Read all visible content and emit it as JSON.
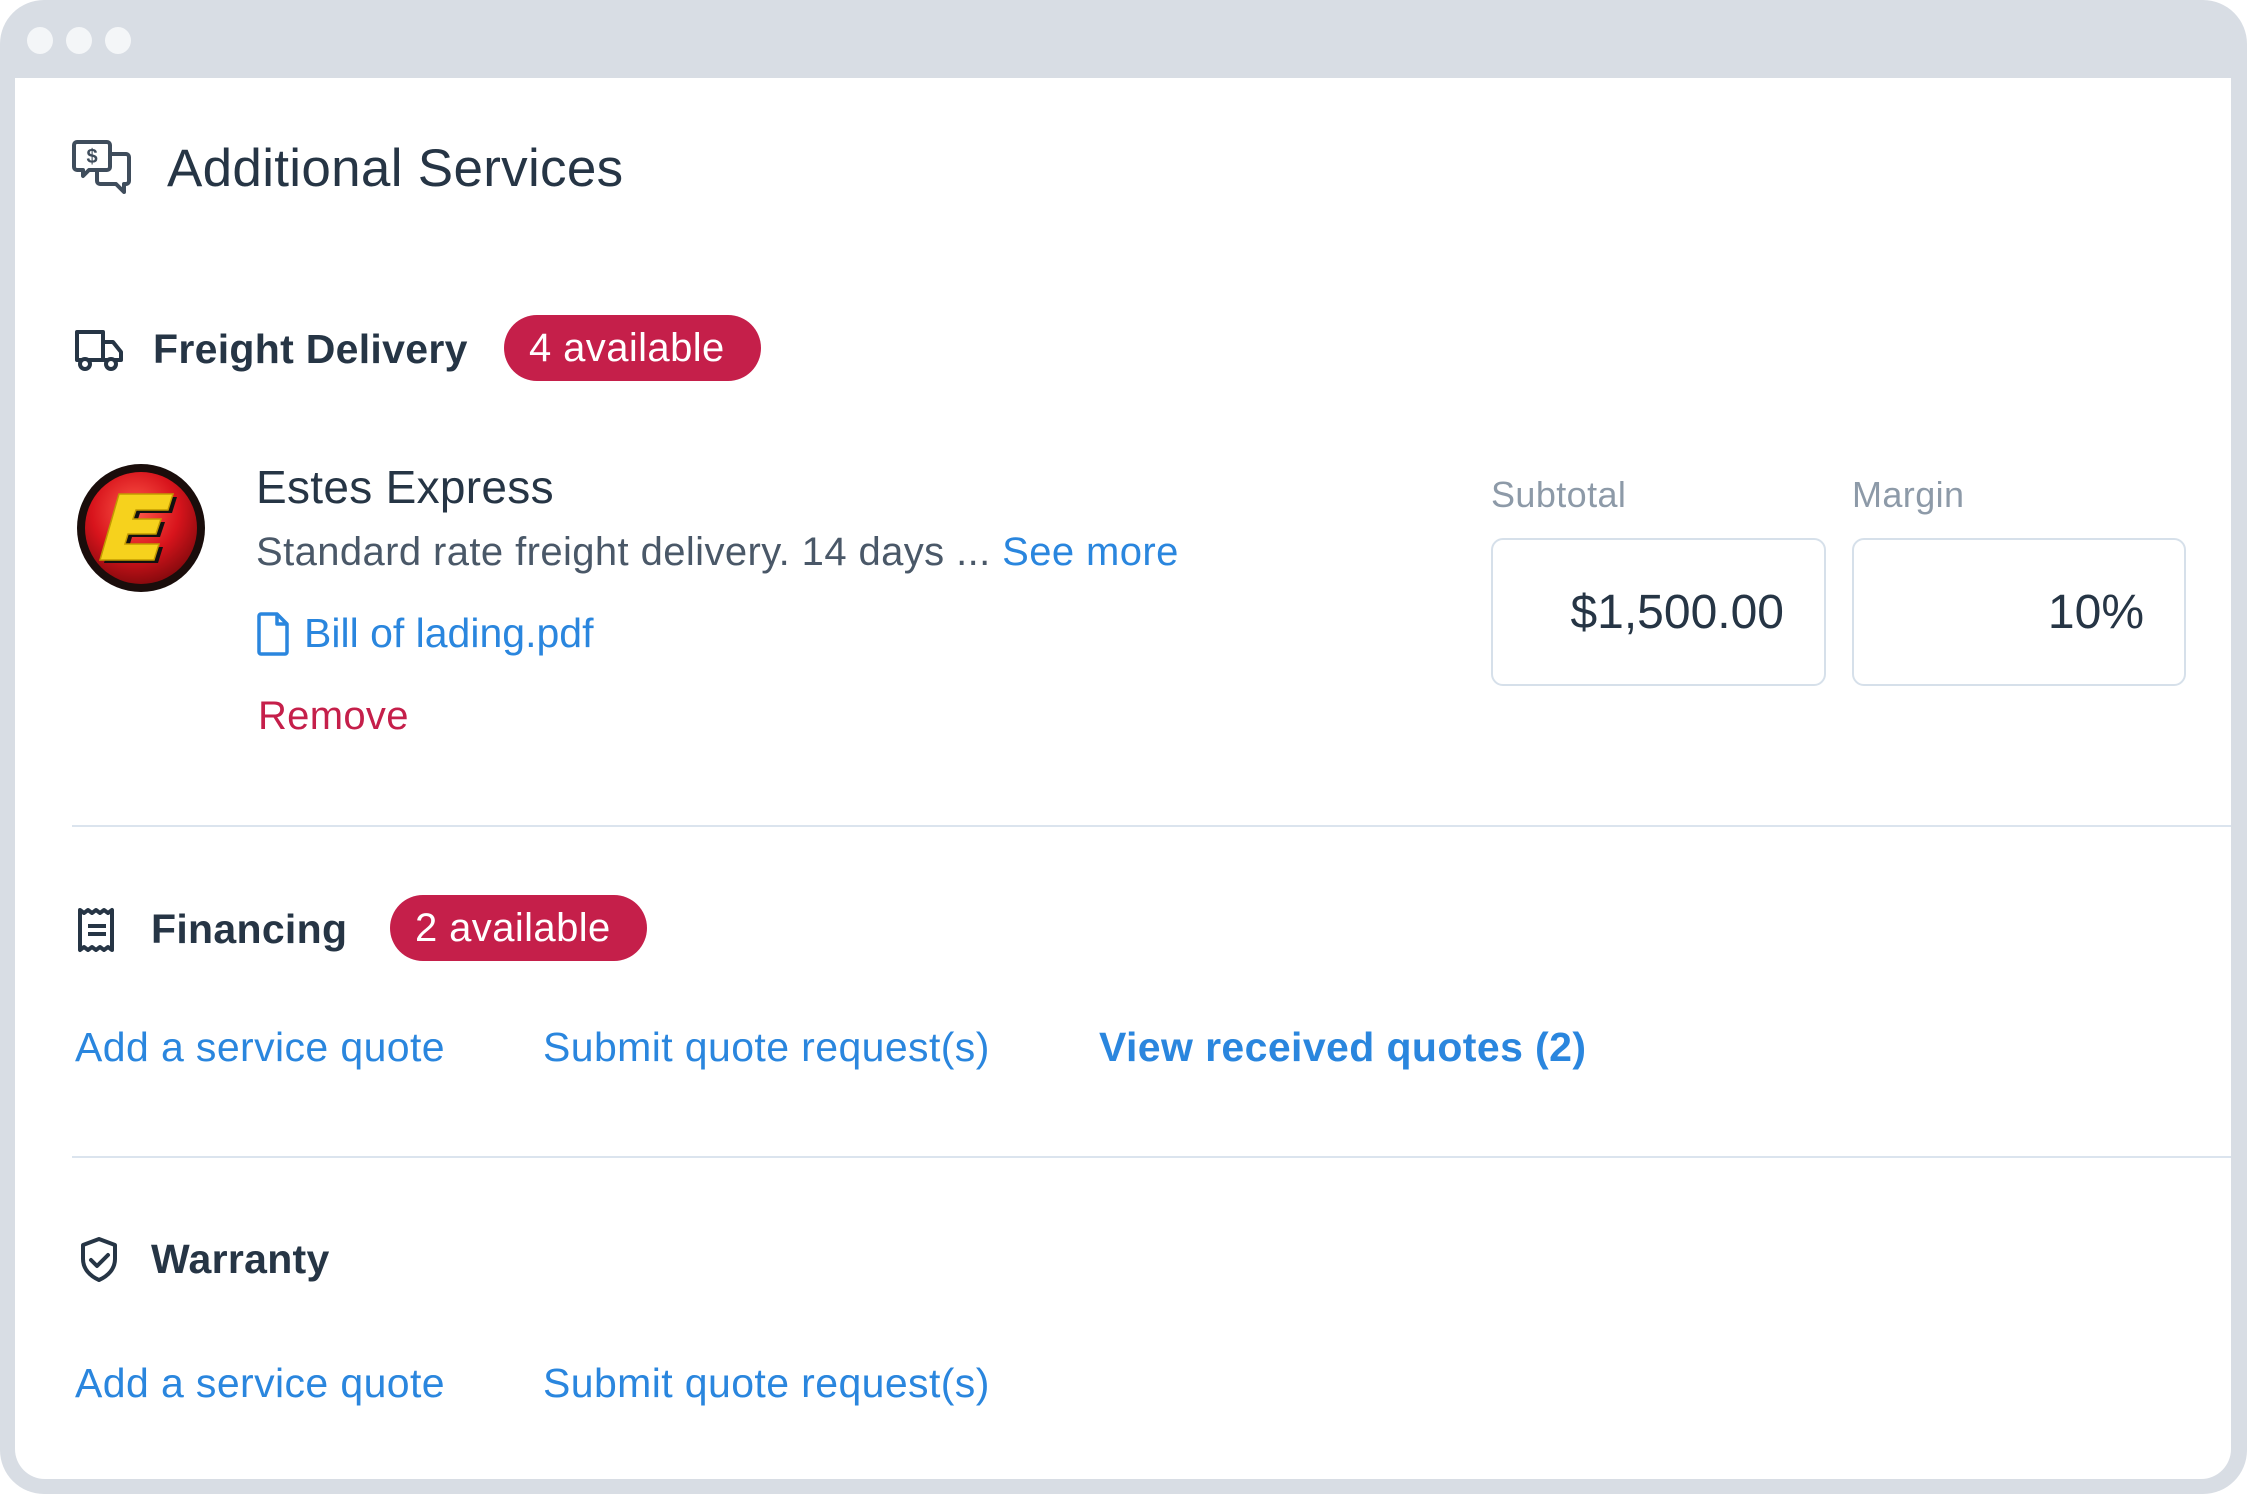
{
  "window": {
    "title": "Additional Services"
  },
  "header": {
    "icon": "chat-dollar-icon",
    "title": "Additional Services"
  },
  "sections": {
    "freight": {
      "icon": "truck-icon",
      "label": "Freight Delivery",
      "badge": "4 available",
      "vendor": {
        "logo": "estes-express-logo",
        "name": "Estes Express",
        "description": "Standard rate freight delivery. 14 days ...",
        "see_more": "See more",
        "file_icon": "document-icon",
        "file_name": "Bill of lading.pdf",
        "remove": "Remove",
        "subtotal_label": "Subtotal",
        "subtotal_value": "$1,500.00",
        "margin_label": "Margin",
        "margin_value": "10%"
      }
    },
    "financing": {
      "icon": "receipt-icon",
      "label": "Financing",
      "badge": "2 available",
      "links": {
        "add_quote": "Add a service quote",
        "submit_request": "Submit quote request(s)",
        "view_received": "View received quotes (2)"
      }
    },
    "warranty": {
      "icon": "shield-check-icon",
      "label": "Warranty",
      "links": {
        "add_quote": "Add a service quote",
        "submit_request": "Submit quote request(s)"
      }
    }
  },
  "colors": {
    "accent_link": "#2a86de",
    "badge": "#c51f4a",
    "danger": "#c51f4a",
    "text": "#263545",
    "muted": "#8d9aa8",
    "frame": "#d8dde4"
  }
}
